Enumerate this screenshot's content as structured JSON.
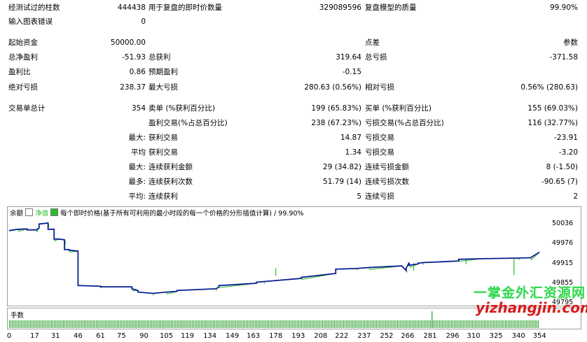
{
  "report": {
    "bars_tested_label": "经测试过的柱数",
    "bars_tested_value": "444438",
    "ticks_label": "用于复盘的即时价数量",
    "ticks_value": "329089596",
    "quality_label": "复盘模型的质量",
    "quality_value": "99.90%",
    "chart_errors_label": "输入图表错误",
    "chart_errors_value": "0",
    "initial_deposit_label": "起始资金",
    "initial_deposit_value": "50000.00",
    "spread_label": "点差",
    "spread_value": "参数",
    "net_profit_label": "总净盈利",
    "net_profit_value": "-51.93",
    "gross_profit_label": "总获利",
    "gross_profit_value": "319.64",
    "gross_loss_label": "总亏损",
    "gross_loss_value": "-371.58",
    "profit_factor_label": "盈利比",
    "profit_factor_value": "0.86",
    "expected_payoff_label": "预期盈利",
    "expected_payoff_value": "-0.15",
    "abs_drawdown_label": "绝对亏损",
    "abs_drawdown_value": "238.37",
    "max_drawdown_label": "最大亏损",
    "max_drawdown_value": "280.63 (0.56%)",
    "rel_drawdown_label": "相对亏损",
    "rel_drawdown_value": "0.56% (280.63)",
    "total_trades_label": "交易单总计",
    "total_trades_value": "354",
    "short_label": "卖单 (%获利百分比)",
    "short_value": "199 (65.83%)",
    "long_label": "买单 (%获利百分比)",
    "long_value": "155 (69.03%)",
    "profit_trades_label": "盈利交易(%占总百分比)",
    "profit_trades_value": "238 (67.23%)",
    "loss_trades_label": "亏损交易(%占总百分比)",
    "loss_trades_value": "116 (32.77%)",
    "largest_prefix": "最大:",
    "largest_profit_label": "获利交易",
    "largest_profit_value": "14.87",
    "largest_loss_label": "亏损交易",
    "largest_loss_value": "-23.91",
    "average_prefix": "平均",
    "average_profit_label": "获利交易",
    "average_profit_value": "1.34",
    "average_loss_label": "亏损交易",
    "average_loss_value": "-3.20",
    "max_prefix": "最大:",
    "max_consec_wins_label": "连续获利金额",
    "max_consec_wins_value": "29 (34.82)",
    "max_consec_losses_label": "连续亏损金额",
    "max_consec_losses_value": "8 (-1.50)",
    "maximal_prefix": "最多:",
    "maximal_consec_profit_label": "连续获利次数",
    "maximal_consec_profit_value": "51.79 (14)",
    "maximal_consec_loss_label": "连续亏损次数",
    "maximal_consec_loss_value": "-90.65 (7)",
    "avg_prefix": "平均:",
    "avg_consec_wins_label": "连续获利",
    "avg_consec_wins_value": "5",
    "avg_consec_losses_label": "连续亏损",
    "avg_consec_losses_value": "2"
  },
  "chart": {
    "legend_balance": "余额",
    "legend_equity": "净值",
    "header_text": "每个即时价格(基于所有可利用的最小时段的每一个价格的分形插值计算) / 99.90%",
    "volume_label": "手数",
    "watermark_cn": "一掌金外汇资源网",
    "watermark_url": "yizhangjin.com",
    "colors": {
      "balance": "#0a1f8f",
      "equity": "#2db82d",
      "volume": "#2aa02a"
    }
  },
  "chart_data": {
    "type": "line",
    "y_ticks": [
      "50036",
      "49976",
      "49915",
      "49855",
      "49795"
    ],
    "x_ticks": [
      "0",
      "17",
      "31",
      "46",
      "61",
      "75",
      "90",
      "105",
      "119",
      "134",
      "149",
      "163",
      "178",
      "193",
      "208",
      "222",
      "237",
      "252",
      "266",
      "281",
      "296",
      "310",
      "325",
      "340",
      "354"
    ],
    "ylim": [
      49795,
      50060
    ],
    "xlim": [
      0,
      360
    ],
    "series": [
      {
        "name": "余额",
        "x": [
          0,
          6,
          12,
          12,
          18,
          20,
          20,
          26,
          26,
          30,
          30,
          33,
          33,
          37,
          37,
          40,
          40,
          46,
          46,
          61,
          61,
          82,
          82,
          86,
          86,
          96,
          96,
          105,
          105,
          112,
          112,
          138,
          138,
          140,
          140,
          165,
          165,
          170,
          170,
          195,
          195,
          218,
          218,
          232,
          232,
          240,
          240,
          262,
          262,
          265,
          265,
          267,
          267,
          273,
          273,
          276,
          276,
          300,
          300,
          316,
          316,
          340,
          340,
          348,
          348,
          354
        ],
        "y": [
          50018,
          50022,
          50023,
          50020,
          50020,
          50026,
          50038,
          50041,
          50022,
          50022,
          49992,
          49992,
          49992,
          49990,
          49960,
          49960,
          49958,
          49955,
          49850,
          49848,
          49846,
          49846,
          49840,
          49835,
          49830,
          49826,
          49826,
          49830,
          49830,
          49832,
          49835,
          49840,
          49840,
          49845,
          49850,
          49857,
          49860,
          49862,
          49862,
          49872,
          49875,
          49887,
          49900,
          49902,
          49902,
          49905,
          49905,
          49910,
          49910,
          49896,
          49903,
          49920,
          49912,
          49916,
          49918,
          49920,
          49920,
          49925,
          49930,
          49932,
          49932,
          49934,
          49934,
          49935,
          49935,
          49952
        ]
      }
    ]
  }
}
